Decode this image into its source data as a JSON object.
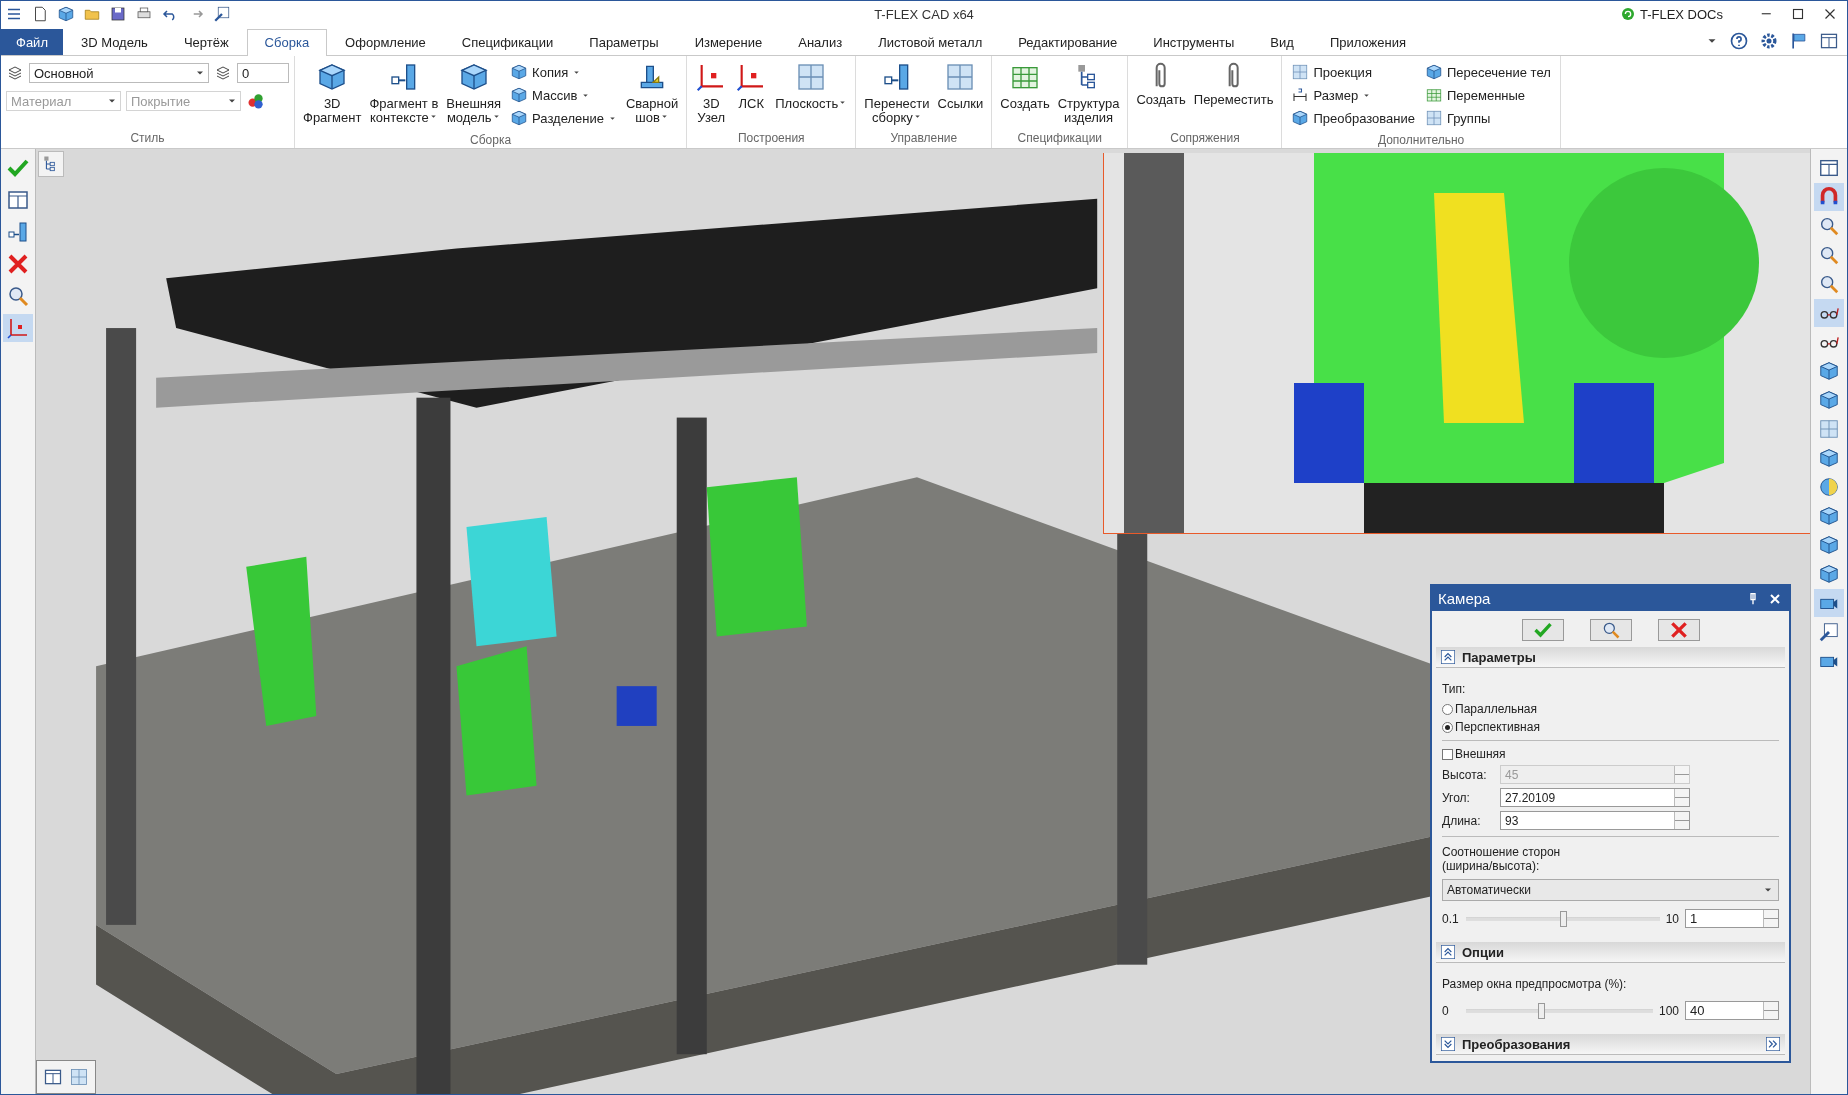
{
  "window": {
    "title": "T-FLEX CAD x64",
    "docs_button": "T-FLEX DOCs"
  },
  "tabs": [
    {
      "label": "Файл",
      "kind": "file",
      "selected": false
    },
    {
      "label": "3D Модель",
      "kind": "tab",
      "selected": false
    },
    {
      "label": "Чертёж",
      "kind": "tab",
      "selected": false
    },
    {
      "label": "Сборка",
      "kind": "tab",
      "selected": true
    },
    {
      "label": "Оформление",
      "kind": "tab",
      "selected": false
    },
    {
      "label": "Спецификации",
      "kind": "tab",
      "selected": false
    },
    {
      "label": "Параметры",
      "kind": "tab",
      "selected": false
    },
    {
      "label": "Измерение",
      "kind": "tab",
      "selected": false
    },
    {
      "label": "Анализ",
      "kind": "tab",
      "selected": false
    },
    {
      "label": "Листовой металл",
      "kind": "tab",
      "selected": false
    },
    {
      "label": "Редактирование",
      "kind": "tab",
      "selected": false
    },
    {
      "label": "Инструменты",
      "kind": "tab",
      "selected": false
    },
    {
      "label": "Вид",
      "kind": "tab",
      "selected": false
    },
    {
      "label": "Приложения",
      "kind": "tab",
      "selected": false
    }
  ],
  "ribbon": {
    "style_group": {
      "label": "Стиль",
      "layer": "Основной",
      "layer_number": "0",
      "material_placeholder": "Материал",
      "coating_placeholder": "Покрытие",
      "disabled": true
    },
    "groups": [
      {
        "label": "Сборка",
        "items": [
          {
            "kind": "large",
            "lines": [
              "3D",
              "Фрагмент"
            ],
            "dropdown": false
          },
          {
            "kind": "large",
            "lines": [
              "Фрагмент в",
              "контексте"
            ],
            "dropdown": true
          },
          {
            "kind": "large",
            "lines": [
              "Внешняя",
              "модель"
            ],
            "dropdown": true
          },
          {
            "kind": "stack",
            "tools": [
              {
                "label": "Копия",
                "dropdown": true
              },
              {
                "label": "Массив",
                "dropdown": true
              },
              {
                "label": "Разделение",
                "dropdown": true
              }
            ]
          },
          {
            "kind": "large",
            "lines": [
              "Сварной",
              "шов"
            ],
            "dropdown": true
          }
        ]
      },
      {
        "label": "Построения",
        "items": [
          {
            "kind": "large",
            "lines": [
              "3D",
              "Узел"
            ],
            "dropdown": false
          },
          {
            "kind": "large",
            "lines": [
              "ЛСК"
            ],
            "dropdown": false
          },
          {
            "kind": "large",
            "lines": [
              "Плоскость"
            ],
            "dropdown": true
          }
        ]
      },
      {
        "label": "Управление",
        "items": [
          {
            "kind": "large",
            "lines": [
              "Перенести",
              "сборку"
            ],
            "dropdown": true
          },
          {
            "kind": "large",
            "lines": [
              "Ссылки"
            ],
            "dropdown": false
          }
        ]
      },
      {
        "label": "Спецификации",
        "items": [
          {
            "kind": "large",
            "lines": [
              "Создать"
            ],
            "dropdown": false
          },
          {
            "kind": "large",
            "lines": [
              "Структура",
              "изделия"
            ],
            "dropdown": false
          }
        ]
      },
      {
        "label": "Сопряжения",
        "items": [
          {
            "kind": "large",
            "lines": [
              "Создать"
            ],
            "dropdown": false
          },
          {
            "kind": "large",
            "lines": [
              "Переместить"
            ],
            "dropdown": false
          }
        ]
      },
      {
        "label": "Дополнительно",
        "items": [
          {
            "kind": "stack",
            "tools": [
              {
                "label": "Проекция",
                "dropdown": false
              },
              {
                "label": "Размер",
                "dropdown": true
              },
              {
                "label": "Преобразование",
                "dropdown": false
              }
            ]
          },
          {
            "kind": "stack",
            "tools": [
              {
                "label": "Пересечение тел",
                "dropdown": false
              },
              {
                "label": "Переменные",
                "dropdown": false
              },
              {
                "label": "Группы",
                "dropdown": false
              }
            ]
          }
        ]
      }
    ]
  },
  "left_toolbar": [
    {
      "active": false
    },
    {
      "active": false
    },
    {
      "active": false
    },
    {
      "active": false
    },
    {
      "active": false
    },
    {
      "active": true
    }
  ],
  "right_toolbar": [
    {
      "active": false
    },
    {
      "active": true
    },
    {
      "active": false
    },
    {
      "active": false
    },
    {
      "active": false
    },
    {
      "active": true
    },
    {
      "active": false
    },
    {
      "active": false
    },
    {
      "active": false
    },
    {
      "active": false
    },
    {
      "active": false
    },
    {
      "active": false
    },
    {
      "active": false
    },
    {
      "active": false
    },
    {
      "active": false
    },
    {
      "active": true
    },
    {
      "active": false
    },
    {
      "active": false
    }
  ],
  "viewport": {
    "kind": "picture"
  },
  "camera_panel": {
    "title": "Камера",
    "sections": [
      {
        "kind": "parameters",
        "title": "Параметры",
        "expanded": true,
        "content": {
          "type_label": "Тип:",
          "radios": [
            {
              "label": "Параллельная",
              "selected": false
            },
            {
              "label": "Перспективная",
              "selected": true
            }
          ],
          "external": {
            "label": "Внешняя",
            "checked": false
          },
          "fields": [
            {
              "label": "Высота:",
              "value": "45",
              "disabled": true
            },
            {
              "label": "Угол:",
              "value": "27.20109",
              "disabled": false
            },
            {
              "label": "Длина:",
              "value": "93",
              "disabled": false
            }
          ],
          "ratio_label": "Соотношение сторон (ширина/высота):",
          "ratio_select": "Автоматически",
          "ratio_slider": {
            "min": "0.1",
            "max": "10",
            "level": 0.5,
            "value": "1"
          }
        }
      },
      {
        "kind": "options",
        "title": "Опции",
        "expanded": true,
        "content": {
          "preview_label": "Размер окна предпросмотра (%):",
          "slider": {
            "min": "0",
            "max": "100",
            "level": 0.4,
            "value": "40"
          }
        }
      },
      {
        "kind": "transforms",
        "title": "Преобразования",
        "expanded": false
      }
    ]
  }
}
